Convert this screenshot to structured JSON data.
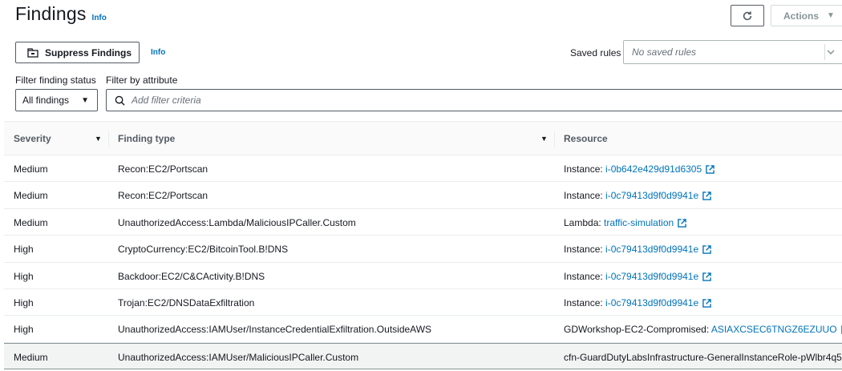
{
  "header": {
    "title": "Findings",
    "info": "Info",
    "actions_label": "Actions"
  },
  "toolbar": {
    "suppress_label": "Suppress Findings",
    "info": "Info",
    "saved_rules_label": "Saved rules",
    "saved_rules_placeholder": "No saved rules"
  },
  "filters": {
    "status_label": "Filter finding status",
    "status_value": "All findings",
    "attribute_label": "Filter by attribute",
    "attribute_placeholder": "Add filter criteria"
  },
  "table": {
    "columns": [
      "Severity",
      "Finding type",
      "Resource"
    ],
    "rows": [
      {
        "severity": "Medium",
        "type": "Recon:EC2/Portscan",
        "res_prefix": "Instance: ",
        "res_link": "i-0b642e429d91d6305",
        "ext": true
      },
      {
        "severity": "Medium",
        "type": "Recon:EC2/Portscan",
        "res_prefix": "Instance: ",
        "res_link": "i-0c79413d9f0d9941e",
        "ext": true
      },
      {
        "severity": "Medium",
        "type": "UnauthorizedAccess:Lambda/MaliciousIPCaller.Custom",
        "res_prefix": "Lambda: ",
        "res_link": "traffic-simulation",
        "ext": true
      },
      {
        "severity": "High",
        "type": "CryptoCurrency:EC2/BitcoinTool.B!DNS",
        "res_prefix": "Instance: ",
        "res_link": "i-0c79413d9f0d9941e",
        "ext": true
      },
      {
        "severity": "High",
        "type": "Backdoor:EC2/C&CActivity.B!DNS",
        "res_prefix": "Instance: ",
        "res_link": "i-0c79413d9f0d9941e",
        "ext": true
      },
      {
        "severity": "High",
        "type": "Trojan:EC2/DNSDataExfiltration",
        "res_prefix": "Instance: ",
        "res_link": "i-0c79413d9f0d9941e",
        "ext": true
      },
      {
        "severity": "High",
        "type": "UnauthorizedAccess:IAMUser/InstanceCredentialExfiltration.OutsideAWS",
        "res_prefix": "GDWorkshop-EC2-Compromised: ",
        "res_link": "ASIAXCSEC6TNGZ6EZUUO",
        "ext": true
      },
      {
        "severity": "Medium",
        "type": "UnauthorizedAccess:IAMUser/MaliciousIPCaller.Custom",
        "res_prefix": "cfn-GuardDutyLabsInfrastructure-GeneralInstanceRole-pWlbr4q5",
        "res_link": "",
        "ext": false
      }
    ]
  },
  "colors": {
    "link": "#0073bb",
    "text": "#16191f",
    "header_text": "#545b64",
    "border": "#eaeded"
  }
}
